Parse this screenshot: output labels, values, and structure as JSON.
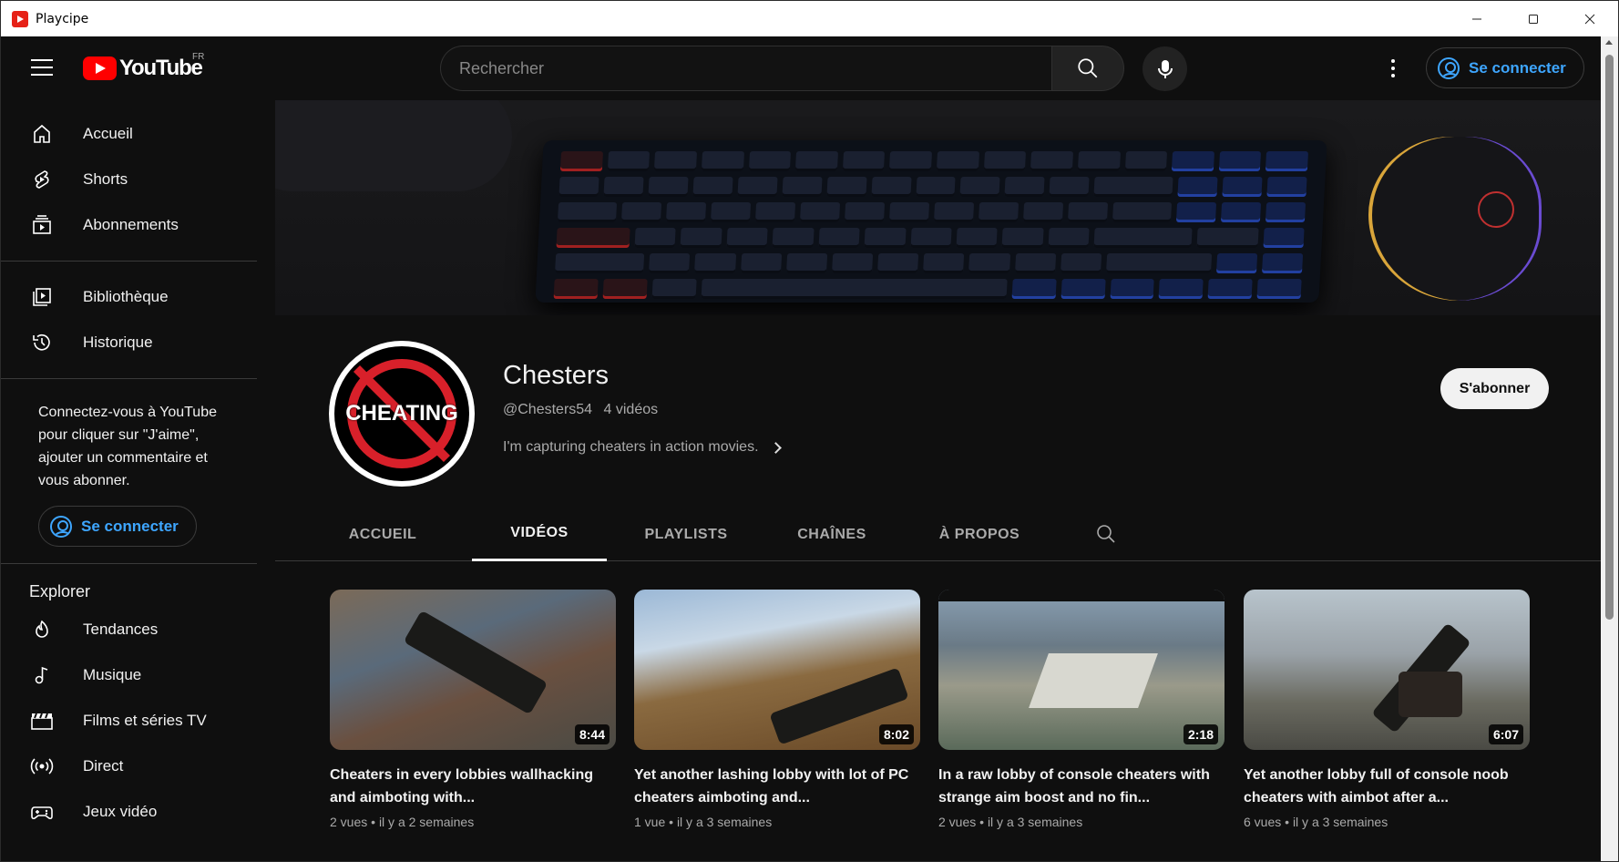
{
  "window": {
    "title": "Playcipe",
    "minimize": "—",
    "maximize": "☐",
    "close": "✕"
  },
  "topbar": {
    "logo_text": "YouTube",
    "country": "FR",
    "search_placeholder": "Rechercher",
    "signin_label": "Se connecter"
  },
  "sidebar": {
    "main": [
      {
        "label": "Accueil",
        "icon": "home-icon"
      },
      {
        "label": "Shorts",
        "icon": "shorts-icon"
      },
      {
        "label": "Abonnements",
        "icon": "subscriptions-icon"
      }
    ],
    "library": [
      {
        "label": "Bibliothèque",
        "icon": "library-icon"
      },
      {
        "label": "Historique",
        "icon": "history-icon"
      }
    ],
    "signin_prompt": "Connectez-vous à YouTube pour cliquer sur \"J'aime\", ajouter un commentaire et vous abonner.",
    "signin_label": "Se connecter",
    "explore_title": "Explorer",
    "explore": [
      {
        "label": "Tendances",
        "icon": "trending-icon"
      },
      {
        "label": "Musique",
        "icon": "music-icon"
      },
      {
        "label": "Films et séries TV",
        "icon": "movies-icon"
      },
      {
        "label": "Direct",
        "icon": "live-icon"
      },
      {
        "label": "Jeux vidéo",
        "icon": "gaming-icon"
      }
    ]
  },
  "channel": {
    "avatar_text": "CHEATING",
    "name": "Chesters",
    "handle": "@Chesters54",
    "video_count": "4 vidéos",
    "description": "I'm capturing cheaters in action movies.",
    "subscribe_label": "S'abonner"
  },
  "tabs": [
    "ACCUEIL",
    "VIDÉOS",
    "PLAYLISTS",
    "CHAÎNES",
    "À PROPOS"
  ],
  "active_tab": "VIDÉOS",
  "videos": [
    {
      "title": "Cheaters in every lobbies wallhacking and aimboting with...",
      "duration": "8:44",
      "views": "2 vues",
      "age": "il y a 2 semaines"
    },
    {
      "title": "Yet another lashing lobby with lot of PC cheaters aimboting and...",
      "duration": "8:02",
      "views": "1 vue",
      "age": "il y a 3 semaines"
    },
    {
      "title": "In a raw lobby of console cheaters with strange aim boost and no fin...",
      "duration": "2:18",
      "views": "2 vues",
      "age": "il y a 3 semaines"
    },
    {
      "title": "Yet another lobby full of console noob cheaters with aimbot after a...",
      "duration": "6:07",
      "views": "6 vues",
      "age": "il y a 3 semaines"
    }
  ],
  "colors": {
    "background": "#0f0f0f",
    "accent_blue": "#3ea6ff",
    "youtube_red": "#ff0000"
  }
}
